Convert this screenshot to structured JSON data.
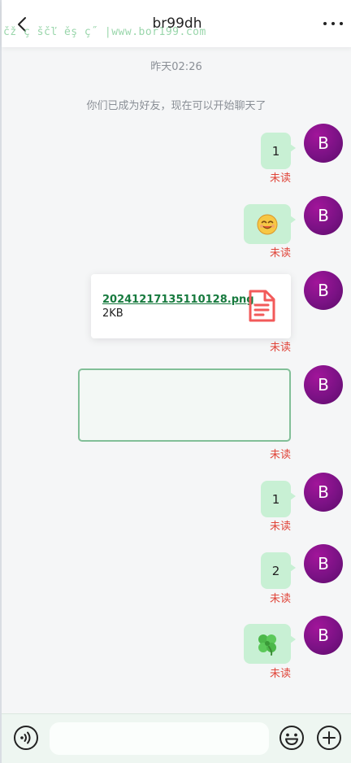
{
  "header": {
    "title": "br99dh",
    "watermark": "čž ç ščľ ěş ç˝ |www.bor199.com"
  },
  "chat": {
    "time_label": "昨天02:26",
    "system_message": "你们已成为好友，现在可以开始聊天了",
    "avatar_letter": "B",
    "unread_label": "未读",
    "messages": [
      {
        "type": "text",
        "text": "1"
      },
      {
        "type": "emoji",
        "icon": "smiley-emoji"
      },
      {
        "type": "file",
        "file_name": "20241217135110128.png",
        "file_size": "2KB",
        "icon": "document-icon"
      },
      {
        "type": "empty"
      },
      {
        "type": "text",
        "text": "1"
      },
      {
        "type": "text",
        "text": "2"
      },
      {
        "type": "emoji",
        "icon": "four-leaf-clover-emoji"
      }
    ]
  },
  "input_bar": {
    "placeholder": "",
    "value": ""
  },
  "colors": {
    "bubble": "#c8f0d4",
    "unread": "#e0453a",
    "avatar": "#7b1285",
    "file_link": "#177a3e",
    "file_icon": "#f25a5a"
  }
}
